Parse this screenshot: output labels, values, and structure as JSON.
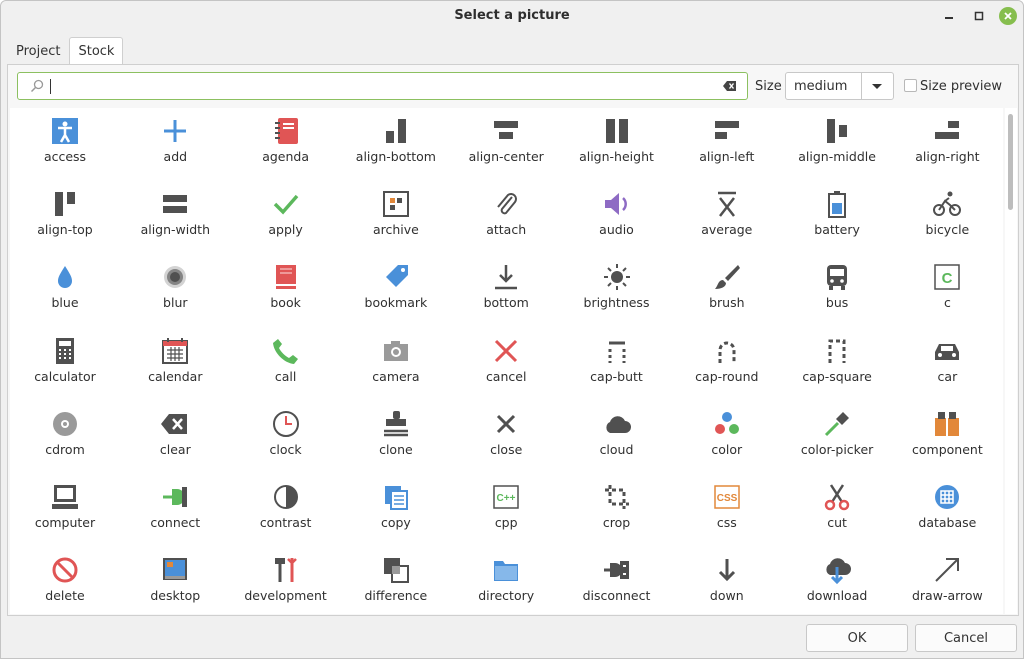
{
  "window": {
    "title": "Select a picture"
  },
  "tabs": [
    {
      "label": "Project"
    },
    {
      "label": "Stock"
    }
  ],
  "search": {
    "value": ""
  },
  "size": {
    "label": "Size",
    "selected": "medium"
  },
  "size_preview": {
    "label": "Size preview",
    "checked": false
  },
  "icons": [
    [
      "access",
      "add",
      "agenda",
      "align-bottom",
      "align-center",
      "align-height",
      "align-left",
      "align-middle",
      "align-right"
    ],
    [
      "align-top",
      "align-width",
      "apply",
      "archive",
      "attach",
      "audio",
      "average",
      "battery",
      "bicycle"
    ],
    [
      "blue",
      "blur",
      "book",
      "bookmark",
      "bottom",
      "brightness",
      "brush",
      "bus",
      "c"
    ],
    [
      "calculator",
      "calendar",
      "call",
      "camera",
      "cancel",
      "cap-butt",
      "cap-round",
      "cap-square",
      "car"
    ],
    [
      "cdrom",
      "clear",
      "clock",
      "clone",
      "close",
      "cloud",
      "color",
      "color-picker",
      "component"
    ],
    [
      "computer",
      "connect",
      "contrast",
      "copy",
      "cpp",
      "crop",
      "css",
      "cut",
      "database"
    ],
    [
      "delete",
      "desktop",
      "development",
      "difference",
      "directory",
      "disconnect",
      "down",
      "download",
      "draw-arrow"
    ]
  ],
  "buttons": {
    "ok": "OK",
    "cancel": "Cancel"
  },
  "colors": {
    "accent_green": "#86be4e",
    "icon_gray": "#505050",
    "icon_blue": "#4a90d9",
    "icon_red": "#e05555",
    "selection_border": "#8cc060"
  }
}
